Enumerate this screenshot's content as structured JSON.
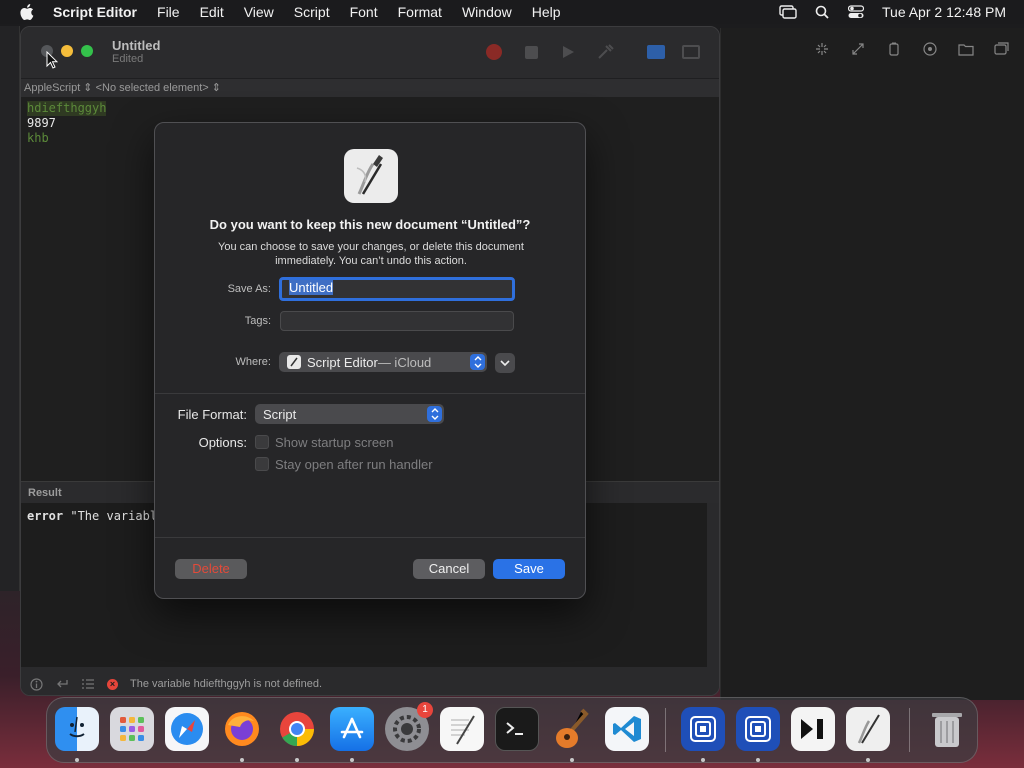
{
  "menubar": {
    "app_name": "Script Editor",
    "items": [
      "File",
      "Edit",
      "View",
      "Script",
      "Font",
      "Format",
      "Window",
      "Help"
    ],
    "clock": "Tue Apr 2  12:48 PM"
  },
  "window": {
    "title": "Untitled",
    "subtitle": "Edited",
    "nav_bar": "AppleScript ⇕ <No selected element> ⇕",
    "code_lines": [
      "hdiefthggyh",
      "9897",
      "khb"
    ],
    "result_header": "Result",
    "result_keyword": "error",
    "result_text": " \"The variable h",
    "status_message": "The variable hdiefthggyh is not defined."
  },
  "dialog": {
    "title": "Do you want to keep this new document “Untitled”?",
    "message": "You can choose to save your changes, or delete this document immediately. You can’t undo this action.",
    "save_as_label": "Save As:",
    "save_as_value": "Untitled",
    "tags_label": "Tags:",
    "tags_value": "",
    "where_label": "Where:",
    "where_value": "Script Editor",
    "where_suffix": " — iCloud",
    "file_format_label": "File Format:",
    "file_format_value": "Script",
    "options_label": "Options:",
    "option_1": "Show startup screen",
    "option_2": "Stay open after run handler",
    "delete_label": "Delete",
    "cancel_label": "Cancel",
    "save_label": "Save"
  },
  "dock": {
    "apps": [
      "Finder",
      "Launchpad",
      "Safari",
      "Firefox",
      "Chrome",
      "App Store",
      "System Settings",
      "TextEdit",
      "Terminal",
      "GarageBand",
      "VS Code",
      "Window App 1",
      "Window App 2",
      "Final Cut",
      "Script Editor",
      "Trash"
    ],
    "settings_badge": "1"
  },
  "colors": {
    "accent": "#2a72e6",
    "destructive": "#e34a3a",
    "error": "#e5453a"
  }
}
